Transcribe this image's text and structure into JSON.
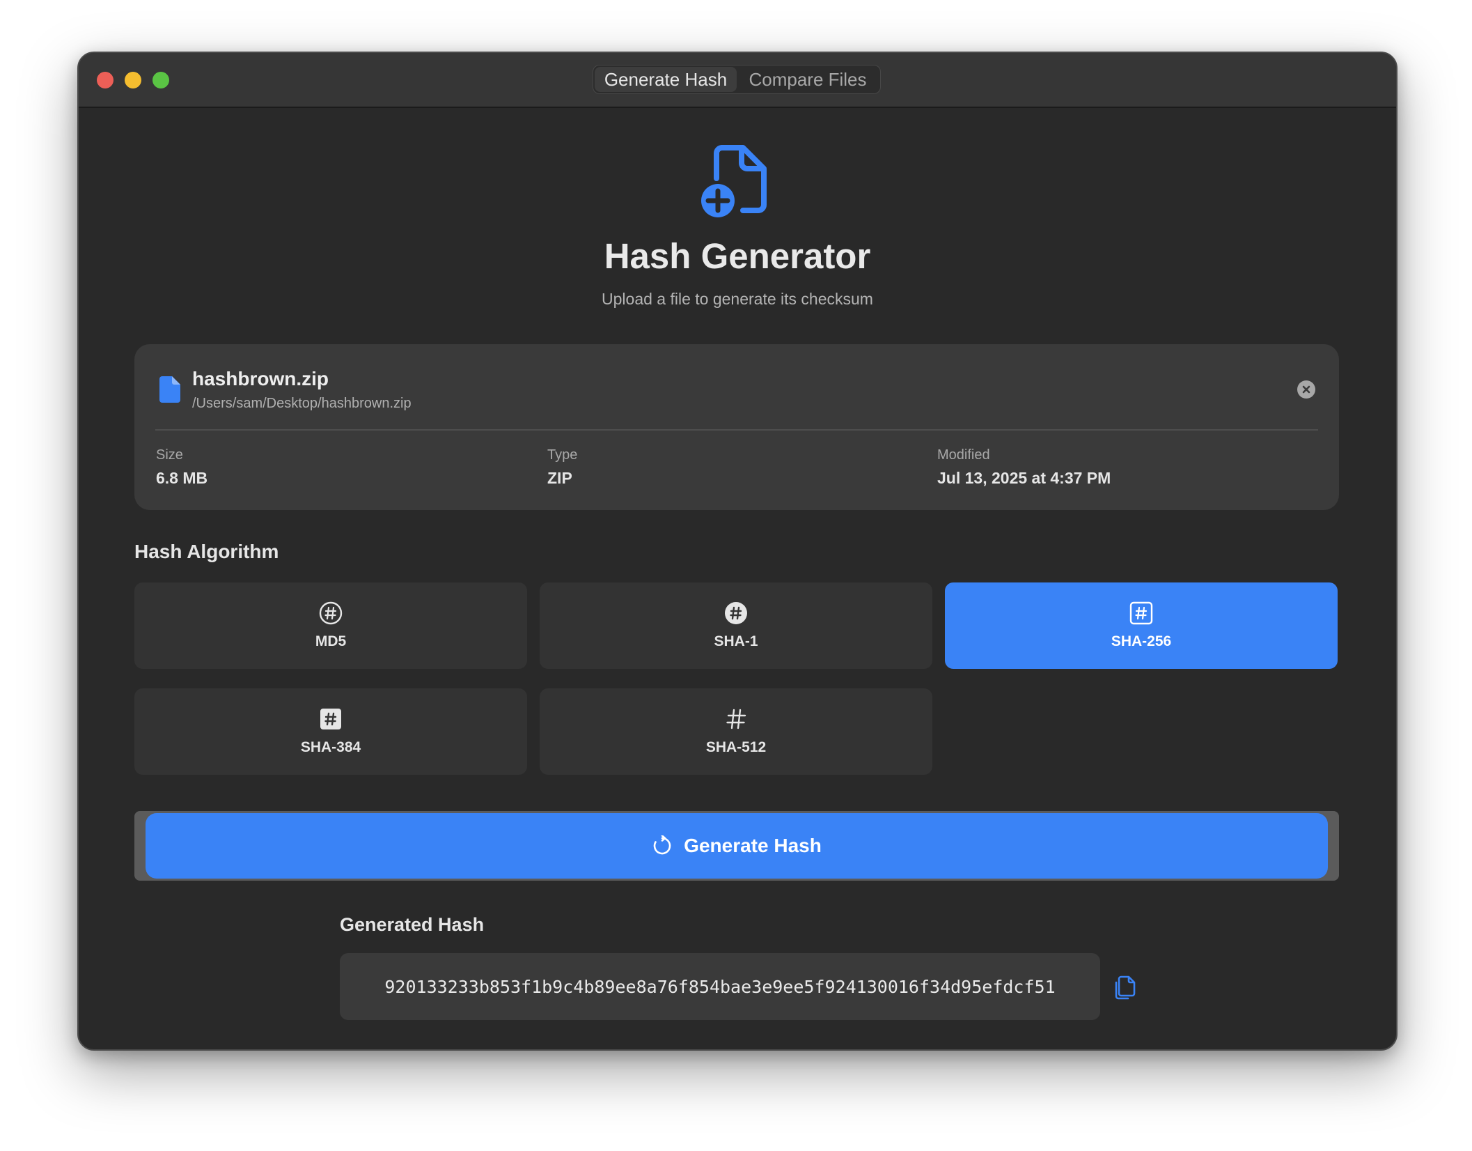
{
  "window": {
    "tabs": [
      {
        "label": "Generate Hash",
        "active": true
      },
      {
        "label": "Compare Files",
        "active": false
      }
    ]
  },
  "header": {
    "icon": "doc-badge-plus-icon",
    "title": "Hash Generator",
    "subtitle": "Upload a file to generate its checksum"
  },
  "file": {
    "icon": "document-icon",
    "name": "hashbrown.zip",
    "path": "/Users/sam/Desktop/hashbrown.zip",
    "remove_icon": "close-circle-icon",
    "meta": [
      {
        "label": "Size",
        "value": "6.8 MB"
      },
      {
        "label": "Type",
        "value": "ZIP"
      },
      {
        "label": "Modified",
        "value": "Jul 13, 2025 at 4:37 PM"
      }
    ]
  },
  "algorithms": {
    "label": "Hash Algorithm",
    "options": [
      {
        "label": "MD5",
        "icon": "number-circle-icon",
        "selected": false
      },
      {
        "label": "SHA-1",
        "icon": "number-circle-fill-icon",
        "selected": false
      },
      {
        "label": "SHA-256",
        "icon": "number-square-icon",
        "selected": true
      },
      {
        "label": "SHA-384",
        "icon": "number-square-fill-icon",
        "selected": false
      },
      {
        "label": "SHA-512",
        "icon": "number-icon",
        "selected": false
      }
    ]
  },
  "actions": {
    "generate_label": "Generate Hash",
    "generate_icon": "arrow-clockwise-icon"
  },
  "result": {
    "label": "Generated Hash",
    "value": "920133233b853f1b9c4b89ee8a76f854bae3e9ee5f924130016f34d95efdcf51",
    "copy_icon": "copy-icon"
  },
  "colors": {
    "accent": "#3a83f6",
    "window_bg": "#292929",
    "card_bg": "#3a3a3a",
    "tile_bg": "#333333"
  }
}
